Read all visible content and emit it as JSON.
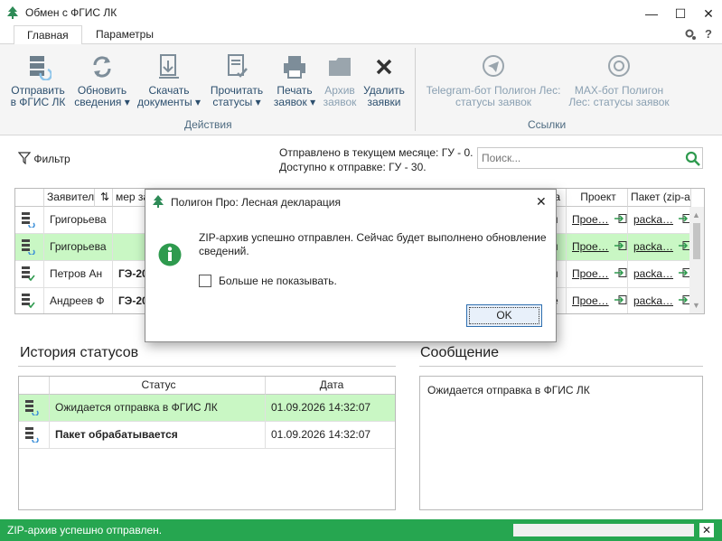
{
  "window": {
    "title": "Обмен с ФГИС ЛК",
    "minimize": "—",
    "maximize": "☐",
    "close": "✕"
  },
  "tabs": [
    {
      "label": "Главная"
    },
    {
      "label": "Параметры"
    }
  ],
  "ribbon": {
    "actions": [
      {
        "l1": "Отправить",
        "l2": "в ФГИС ЛК",
        "icon": "send-server-icon"
      },
      {
        "l1": "Обновить",
        "l2": "сведения ▾",
        "icon": "refresh-icon"
      },
      {
        "l1": "Скачать",
        "l2": "документы ▾",
        "icon": "download-doc-icon"
      },
      {
        "l1": "Прочитать",
        "l2": "статусы ▾",
        "icon": "read-status-icon"
      },
      {
        "l1": "Печать",
        "l2": "заявок ▾",
        "icon": "printer-icon"
      },
      {
        "l1": "Архив",
        "l2": "заявок",
        "icon": "folder-icon"
      },
      {
        "l1": "Удалить",
        "l2": "заявки",
        "icon": "delete-icon"
      }
    ],
    "actions_group": "Действия",
    "links": [
      {
        "l1": "Telegram-бот Полигон Лес:",
        "l2": "статусы заявок",
        "icon": "telegram-icon"
      },
      {
        "l1": "MAX-бот Полигон",
        "l2": "Лес: статусы заявок",
        "icon": "max-bot-icon"
      }
    ],
    "links_group": "Ссылки"
  },
  "toolbar": {
    "filter": "Фильтр",
    "sent_info": "Отправлено в текущем месяце: ГУ - 0.",
    "avail_info": "Доступно к отправке: ГУ - 30.",
    "search_placeholder": "Поиск..."
  },
  "grid": {
    "headers": [
      "",
      "Заявитель",
      "мер за",
      "",
      "",
      "",
      "та",
      "Проект",
      "Пакет (zip-а"
    ],
    "rows": [
      {
        "applicant": "Григорьева",
        "num": "",
        "tail": "п",
        "project": "Прое…",
        "package": "packa…",
        "highlight": false
      },
      {
        "applicant": "Григорьева",
        "num": "",
        "tail": "п",
        "project": "Прое…",
        "package": "packa…",
        "highlight": true
      },
      {
        "applicant": "Петров Ан",
        "num": "ГЭ-20",
        "tail": "п",
        "project": "Прое…",
        "package": "packa…",
        "highlight": false
      },
      {
        "applicant": "Андреев Ф",
        "num": "ГЭ-20",
        "tail": "е",
        "project": "Прое…",
        "package": "packa…",
        "highlight": false
      }
    ]
  },
  "history": {
    "title": "История статусов",
    "col_status": "Статус",
    "col_date": "Дата",
    "rows": [
      {
        "status": "Ожидается отправка в ФГИС ЛК",
        "date": "01.09.2026 14:32:07",
        "bold": false,
        "highlight": true
      },
      {
        "status": "Пакет обрабатывается",
        "date": "01.09.2026 14:32:07",
        "bold": true,
        "highlight": false
      }
    ]
  },
  "message": {
    "title": "Сообщение",
    "text": "Ожидается отправка в ФГИС ЛК"
  },
  "dialog": {
    "title": "Полигон Про: Лесная декларация",
    "text": "ZIP-архив успешно отправлен. Сейчас будет выполнено обновление сведений.",
    "checkbox": "Больше не показывать.",
    "ok": "OK"
  },
  "statusbar": {
    "text": "ZIP-архив успешно отправлен.",
    "close": "✕"
  },
  "colors": {
    "accent": "#26a650",
    "highlight": "#c9f7c4",
    "ribbon_text": "#2c4f6e"
  }
}
